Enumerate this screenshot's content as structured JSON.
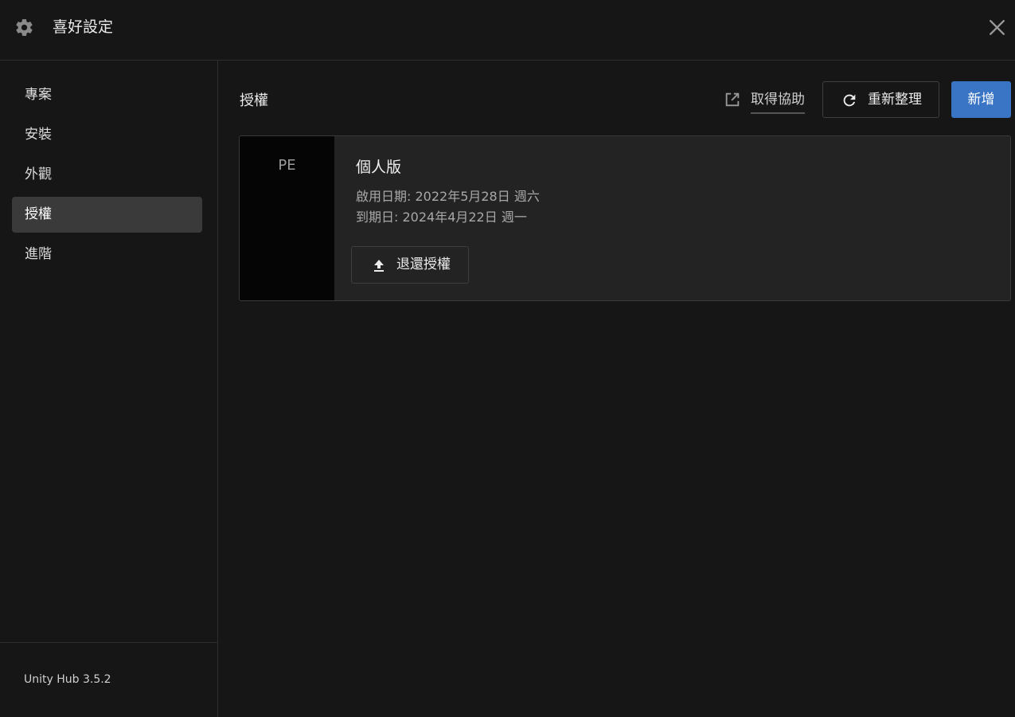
{
  "window": {
    "title": "喜好設定",
    "icons": {
      "settings": "gear-icon",
      "close": "close-icon"
    }
  },
  "sidebar": {
    "items": [
      {
        "label": "專案",
        "active": false
      },
      {
        "label": "安裝",
        "active": false
      },
      {
        "label": "外觀",
        "active": false
      },
      {
        "label": "授權",
        "active": true
      },
      {
        "label": "進階",
        "active": false
      }
    ],
    "version": "Unity Hub 3.5.2"
  },
  "main": {
    "section_title": "授權",
    "help_label": "取得協助",
    "refresh_label": "重新整理",
    "add_label": "新增",
    "icons": {
      "help": "external-link-icon",
      "refresh": "refresh-icon"
    }
  },
  "license": {
    "badge": "PE",
    "plan_name": "個人版",
    "activated": "啟用日期: 2022年5月28日 週六",
    "expires": "到期日: 2024年4月22日 週一",
    "return_label": "退還授權",
    "icons": {
      "return": "upload-arrow-icon"
    }
  },
  "colors": {
    "background": "#161616",
    "card": "#232323",
    "active_nav": "#3a3a3a",
    "accent": "#3a74c5",
    "border": "#3a3a3a"
  }
}
